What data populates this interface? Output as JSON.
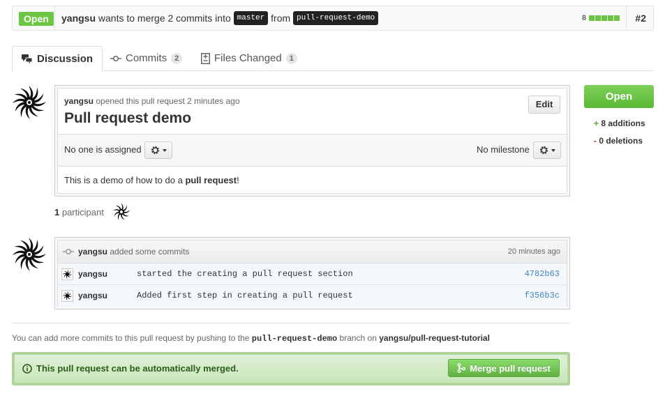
{
  "pr_header": {
    "state": "Open",
    "author": "yangsu",
    "text_before": " wants to merge 2 commits into ",
    "base_branch": "master",
    "text_from": " from ",
    "head_branch": "pull-request-demo",
    "diffstat_count": "8",
    "number": "#2",
    "colors": {
      "open_green": "#6cc644"
    }
  },
  "tabs": [
    {
      "label": "Discussion",
      "icon": "comment-discussion-icon",
      "selected": true
    },
    {
      "label": "Commits",
      "icon": "git-commit-icon",
      "count": "2"
    },
    {
      "label": "Files Changed",
      "icon": "diff-icon",
      "count": "1"
    }
  ],
  "discussion": {
    "author": "yangsu",
    "opened_text": " opened this pull request 2 minutes ago",
    "title": "Pull request demo",
    "edit_label": "Edit",
    "assignee_text": "No one is assigned",
    "milestone_text": "No milestone",
    "body_before": "This is a demo of how to do a ",
    "body_bold": "pull request",
    "body_after": "!"
  },
  "participants": {
    "count": "1",
    "label": " participant"
  },
  "commits_box": {
    "author": "yangsu",
    "action": " added some commits",
    "time": "20 minutes ago",
    "rows": [
      {
        "author": "yangsu",
        "message": "started the creating a pull request section",
        "sha": "4782b63"
      },
      {
        "author": "yangsu",
        "message": "Added first step in creating a pull request",
        "sha": "f356b3c"
      }
    ]
  },
  "push_note": {
    "before": "You can add more commits to this pull request by pushing to the ",
    "branch": "pull-request-demo",
    "middle": " branch on ",
    "repo": "yangsu/pull-request-tutorial"
  },
  "merge": {
    "message": "This pull request can be automatically merged.",
    "button_label": "Merge pull request"
  },
  "sidebar": {
    "state_button": "Open",
    "additions_sign": "+",
    "additions": " 8 additions",
    "deletions_sign": "-",
    "deletions": " 0 deletions"
  }
}
